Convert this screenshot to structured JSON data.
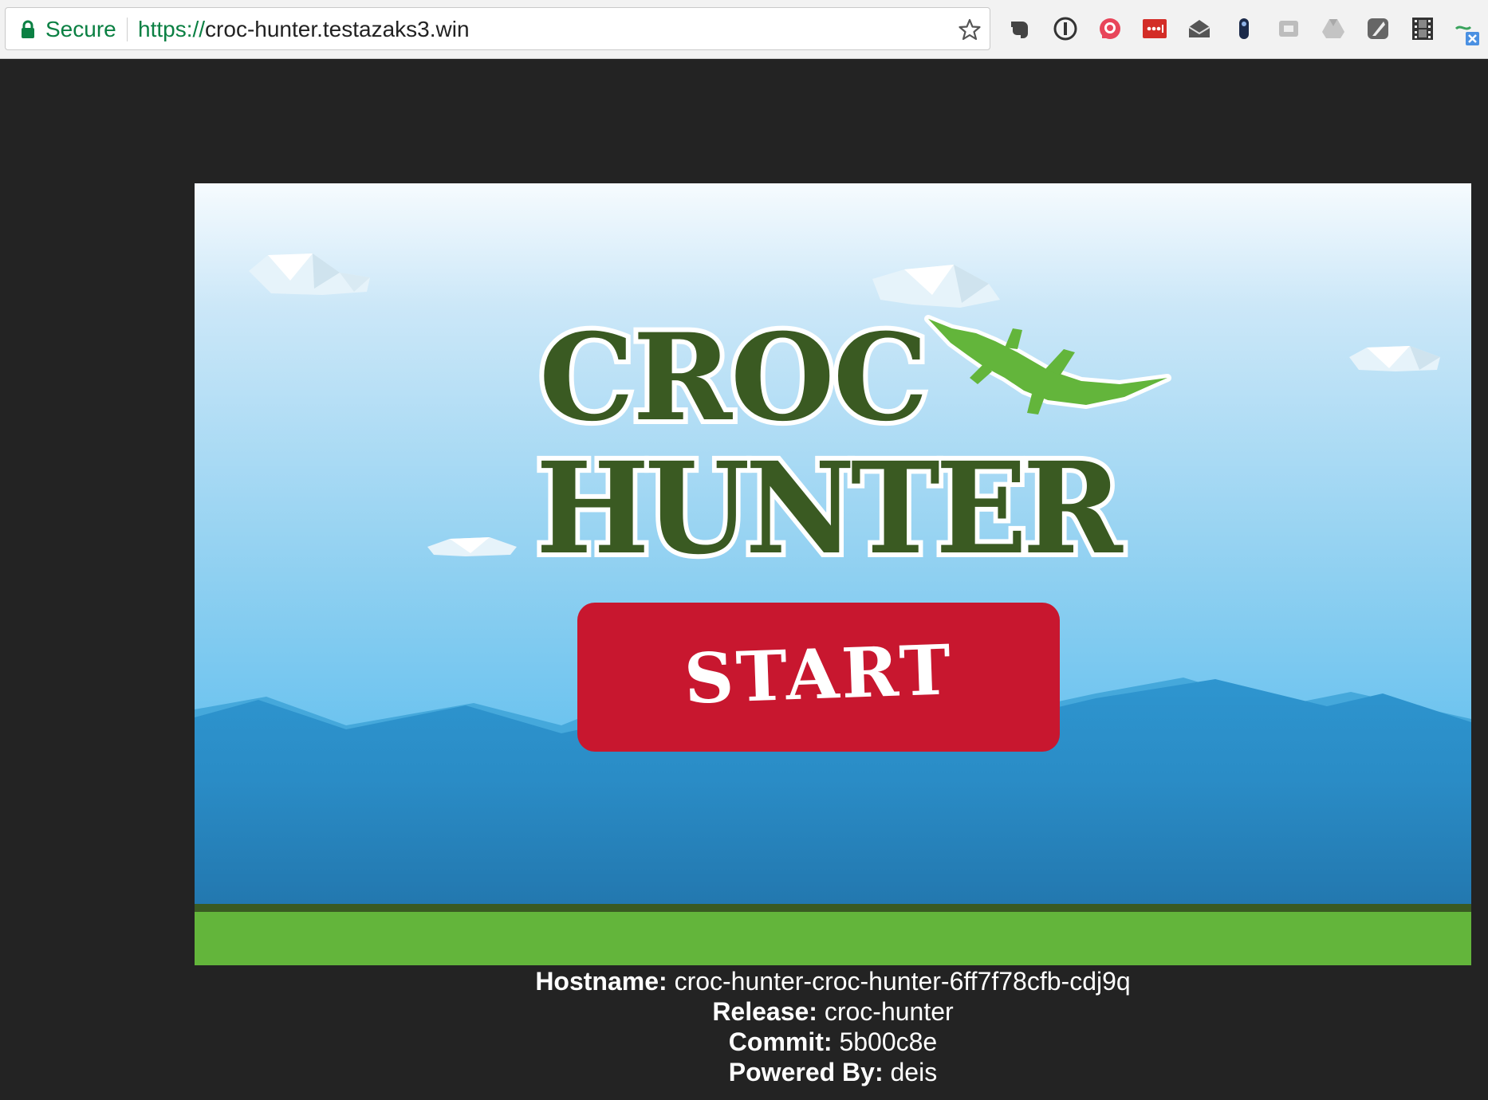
{
  "browser": {
    "secure_label": "Secure",
    "url_scheme": "https://",
    "url_host": "croc-hunter.testazaks3.win",
    "extensions": [
      "evernote-icon",
      "1password-icon",
      "pocket-icon",
      "lastpass-icon",
      "mail-checker-icon",
      "clip-icon",
      "screen-icon",
      "drive-icon",
      "shade-icon",
      "film-icon",
      "translate-icon"
    ]
  },
  "game": {
    "title_line1": "CROC",
    "title_line2": "HUNTER",
    "start_label": "START",
    "colors": {
      "title": "#3a5a22",
      "croc": "#63b53b",
      "button": "#c8172f",
      "grass": "#63b53b",
      "mountains": "#2a8fcb"
    }
  },
  "info": {
    "hostname_label": "Hostname:",
    "hostname_value": "croc-hunter-croc-hunter-6ff7f78cfb-cdj9q",
    "release_label": "Release:",
    "release_value": "croc-hunter",
    "commit_label": "Commit:",
    "commit_value": "5b00c8e",
    "powered_label": "Powered By:",
    "powered_value": "deis"
  }
}
